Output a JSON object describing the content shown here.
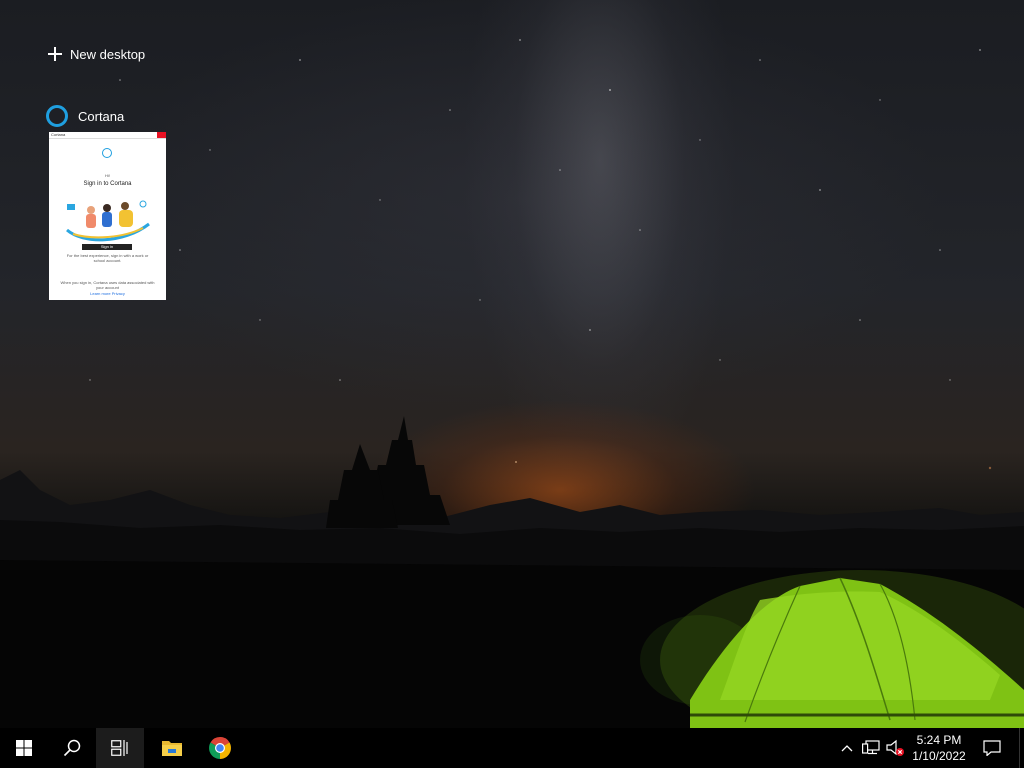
{
  "task_view": {
    "new_desktop_label": "New desktop",
    "windows": [
      {
        "title": "Cortana",
        "icon": "cortana-ring-icon",
        "thumbnail": {
          "titlebar_label": "Cortana",
          "greeting": "Hi!",
          "heading": "Sign in to Cortana",
          "signin_button": "Sign in",
          "body_text": "For the best experience, sign in with a work or school account.",
          "footer_text": "When you sign in, Cortana uses data associated with your account",
          "footer_link": "Learn more  Privacy"
        }
      }
    ]
  },
  "taskbar": {
    "start": {
      "icon": "windows-logo-icon"
    },
    "search": {
      "icon": "search-icon"
    },
    "task_view": {
      "icon": "task-view-icon",
      "active": true
    },
    "pinned": [
      {
        "name": "File Explorer",
        "icon": "folder-icon"
      },
      {
        "name": "Google Chrome",
        "icon": "chrome-icon"
      }
    ],
    "tray": {
      "icons": [
        "chevron-up-icon",
        "network-icon",
        "volume-muted-icon"
      ],
      "time": "5:24 PM",
      "date": "1/10/2022",
      "notification_icon": "action-center-icon"
    }
  },
  "colors": {
    "accent": "#1f9fe0",
    "taskbar": "#000000",
    "tent": "#8fd11a",
    "muted_badge": "#e81123"
  }
}
